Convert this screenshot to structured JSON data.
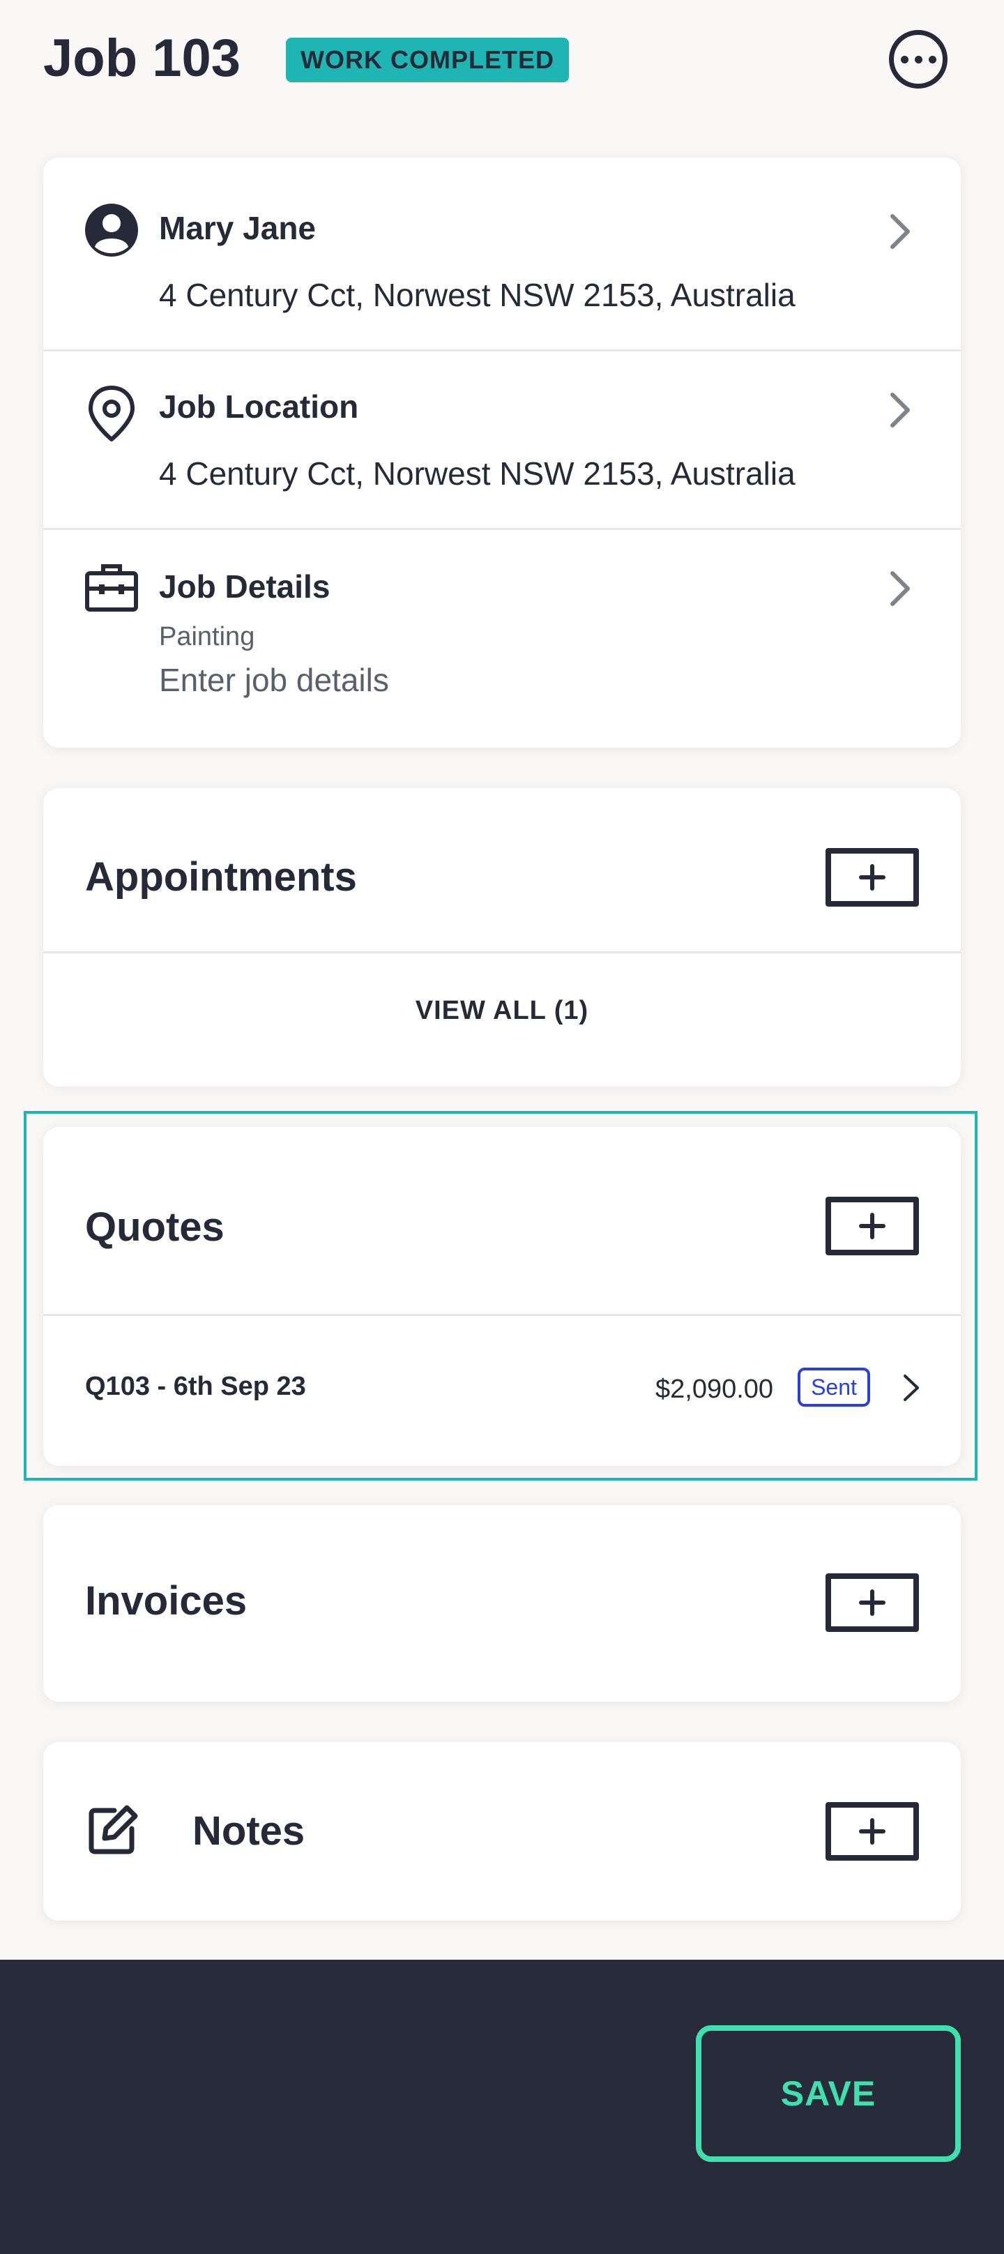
{
  "header": {
    "title": "Job 103",
    "status": "WORK COMPLETED"
  },
  "details_card": {
    "customer": {
      "name": "Mary Jane",
      "address": "4 Century Cct, Norwest NSW 2153, Australia"
    },
    "location": {
      "label": "Job Location",
      "address": "4 Century Cct, Norwest NSW 2153, Australia"
    },
    "job_details": {
      "label": "Job Details",
      "category": "Painting",
      "placeholder": "Enter job details"
    }
  },
  "appointments": {
    "title": "Appointments",
    "view_all": "VIEW ALL (1)"
  },
  "quotes": {
    "title": "Quotes",
    "items": [
      {
        "label": "Q103 - 6th Sep 23",
        "amount": "$2,090.00",
        "status": "Sent"
      }
    ]
  },
  "invoices": {
    "title": "Invoices"
  },
  "notes": {
    "title": "Notes"
  },
  "footer": {
    "save_label": "SAVE"
  },
  "colors": {
    "accent_teal": "#1fb5b3",
    "save_green": "#3fe0ad",
    "sent_blue": "#2b3fe0",
    "dark": "#262a38",
    "footer_bg": "#272b3a"
  }
}
